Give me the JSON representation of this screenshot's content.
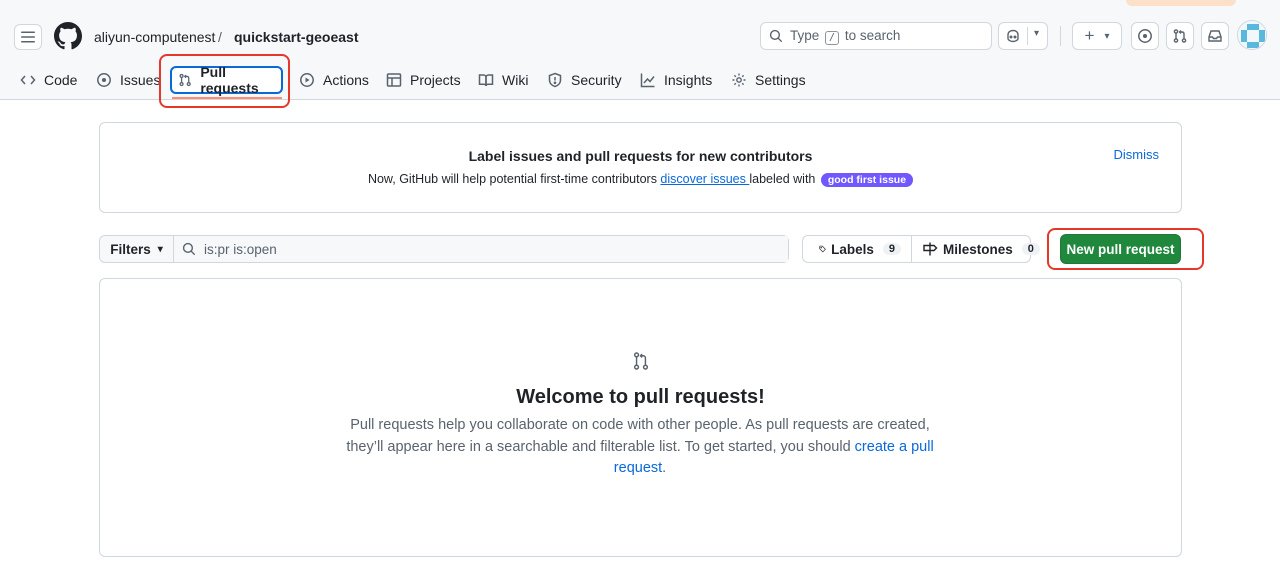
{
  "header": {
    "owner": "aliyun-computenest",
    "separator": "/",
    "repo": "quickstart-geoeast",
    "search": {
      "prefix": "Type",
      "key": "/",
      "suffix": "to search"
    }
  },
  "tabs": [
    {
      "label": "Code",
      "icon": "code-icon"
    },
    {
      "label": "Issues",
      "icon": "issue-opened-icon"
    },
    {
      "label": "Pull requests",
      "icon": "git-pull-request-icon",
      "active": true
    },
    {
      "label": "Actions",
      "icon": "play-icon"
    },
    {
      "label": "Projects",
      "icon": "table-icon"
    },
    {
      "label": "Wiki",
      "icon": "book-icon"
    },
    {
      "label": "Security",
      "icon": "shield-icon"
    },
    {
      "label": "Insights",
      "icon": "graph-icon"
    },
    {
      "label": "Settings",
      "icon": "gear-icon"
    }
  ],
  "banner": {
    "title": "Label issues and pull requests for new contributors",
    "text_before": "Now, GitHub will help potential first-time contributors ",
    "link": "discover issues ",
    "text_after": "labeled with",
    "label": "good first issue",
    "label_color": "#7057ff",
    "dismiss": "Dismiss"
  },
  "filterbar": {
    "filters_label": "Filters",
    "query": "is:pr is:open"
  },
  "labels": {
    "label": "Labels",
    "count": "9"
  },
  "milestones": {
    "label": "Milestones",
    "count": "0"
  },
  "new_pr_button": "New pull request",
  "blankslate": {
    "title": "Welcome to pull requests!",
    "text": "Pull requests help you collaborate on code with other people. As pull requests are created, they’ll appear here in a searchable and filterable list. To get started, you should ",
    "link": "create a pull request",
    "text_end": "."
  },
  "colors": {
    "accent": "#0969da",
    "primary_button": "#1f883d",
    "highlight": "#e5382b",
    "active_tab_underline": "#fd8c73"
  }
}
